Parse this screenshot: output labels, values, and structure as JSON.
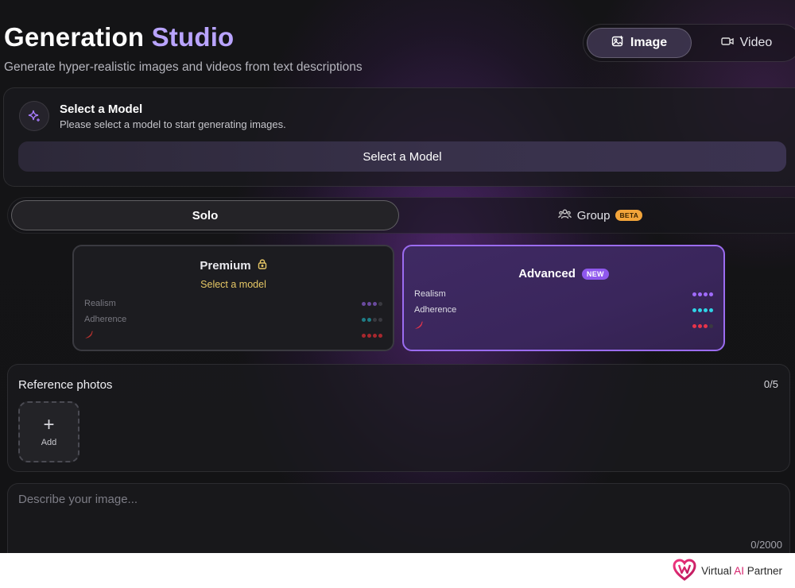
{
  "header": {
    "title_main": "Generation",
    "title_accent": "Studio",
    "subtitle": "Generate hyper-realistic images and videos from text descriptions"
  },
  "mode_toggle": {
    "image_label": "Image",
    "video_label": "Video",
    "selected": "Image"
  },
  "model_select": {
    "heading": "Select a Model",
    "description": "Please select a model to start generating images.",
    "button_label": "Select a Model"
  },
  "generation_type": {
    "solo_label": "Solo",
    "group_label": "Group",
    "group_badge": "BETA",
    "selected": "Solo"
  },
  "tiers": {
    "premium": {
      "title": "Premium",
      "subtitle": "Select a model",
      "locked": true,
      "metrics": [
        {
          "label": "Realism",
          "level": 3,
          "max": 4,
          "color": "#6a4a9e"
        },
        {
          "label": "Adherence",
          "level": 2,
          "max": 4,
          "color": "#1f7d86"
        },
        {
          "label": "",
          "icon": "chili-pepper-icon",
          "level": 4,
          "max": 4,
          "color": "#a8282e"
        }
      ]
    },
    "advanced": {
      "title": "Advanced",
      "badge": "NEW",
      "selected": true,
      "metrics": [
        {
          "label": "Realism",
          "level": 4,
          "max": 4,
          "color": "#a06bff"
        },
        {
          "label": "Adherence",
          "level": 4,
          "max": 4,
          "color": "#2fd3e6"
        },
        {
          "label": "",
          "icon": "chili-pepper-icon",
          "level": 3,
          "max": 4,
          "color": "#e8344a"
        }
      ]
    }
  },
  "reference_photos": {
    "title": "Reference photos",
    "count": "0/5",
    "add_label": "Add"
  },
  "prompt": {
    "placeholder": "Describe your image...",
    "value": "",
    "char_count": "0/2000"
  },
  "footer": {
    "brand_prefix": "Virtual ",
    "brand_ai": "AI",
    "brand_suffix": " Partner"
  },
  "colors": {
    "accent_purple": "#9b6cf0",
    "title_accent": "#b9a4ff",
    "premium_gold": "#e6c765",
    "beta_badge": "#f2a43a",
    "new_badge": "#8f58ee"
  }
}
